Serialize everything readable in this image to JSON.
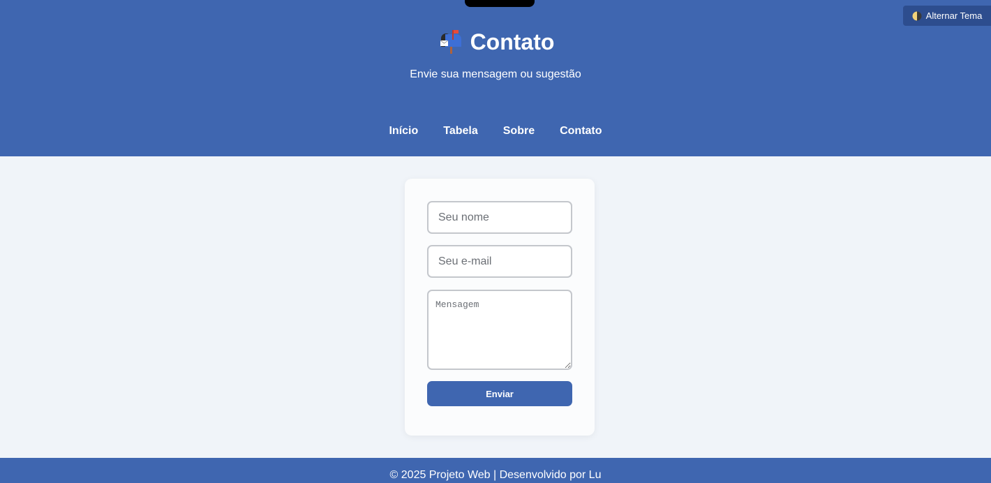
{
  "header": {
    "title": "Contato",
    "title_icon": "mailbox-icon",
    "subtitle": "Envie sua mensagem ou sugestão"
  },
  "nav": {
    "items": [
      {
        "label": "Início"
      },
      {
        "label": "Tabela"
      },
      {
        "label": "Sobre"
      },
      {
        "label": "Contato"
      }
    ]
  },
  "theme_toggle": {
    "icon": "moon-icon",
    "label": "Alternar Tema"
  },
  "form": {
    "name_placeholder": "Seu nome",
    "email_placeholder": "Seu e-mail",
    "message_placeholder": "Mensagem",
    "submit_label": "Enviar"
  },
  "footer": {
    "text": "© 2025 Projeto Web | Desenvolvido por Lu"
  },
  "colors": {
    "primary": "#3f66b0",
    "background": "#f0f4f9",
    "card": "#fbfcfd"
  }
}
